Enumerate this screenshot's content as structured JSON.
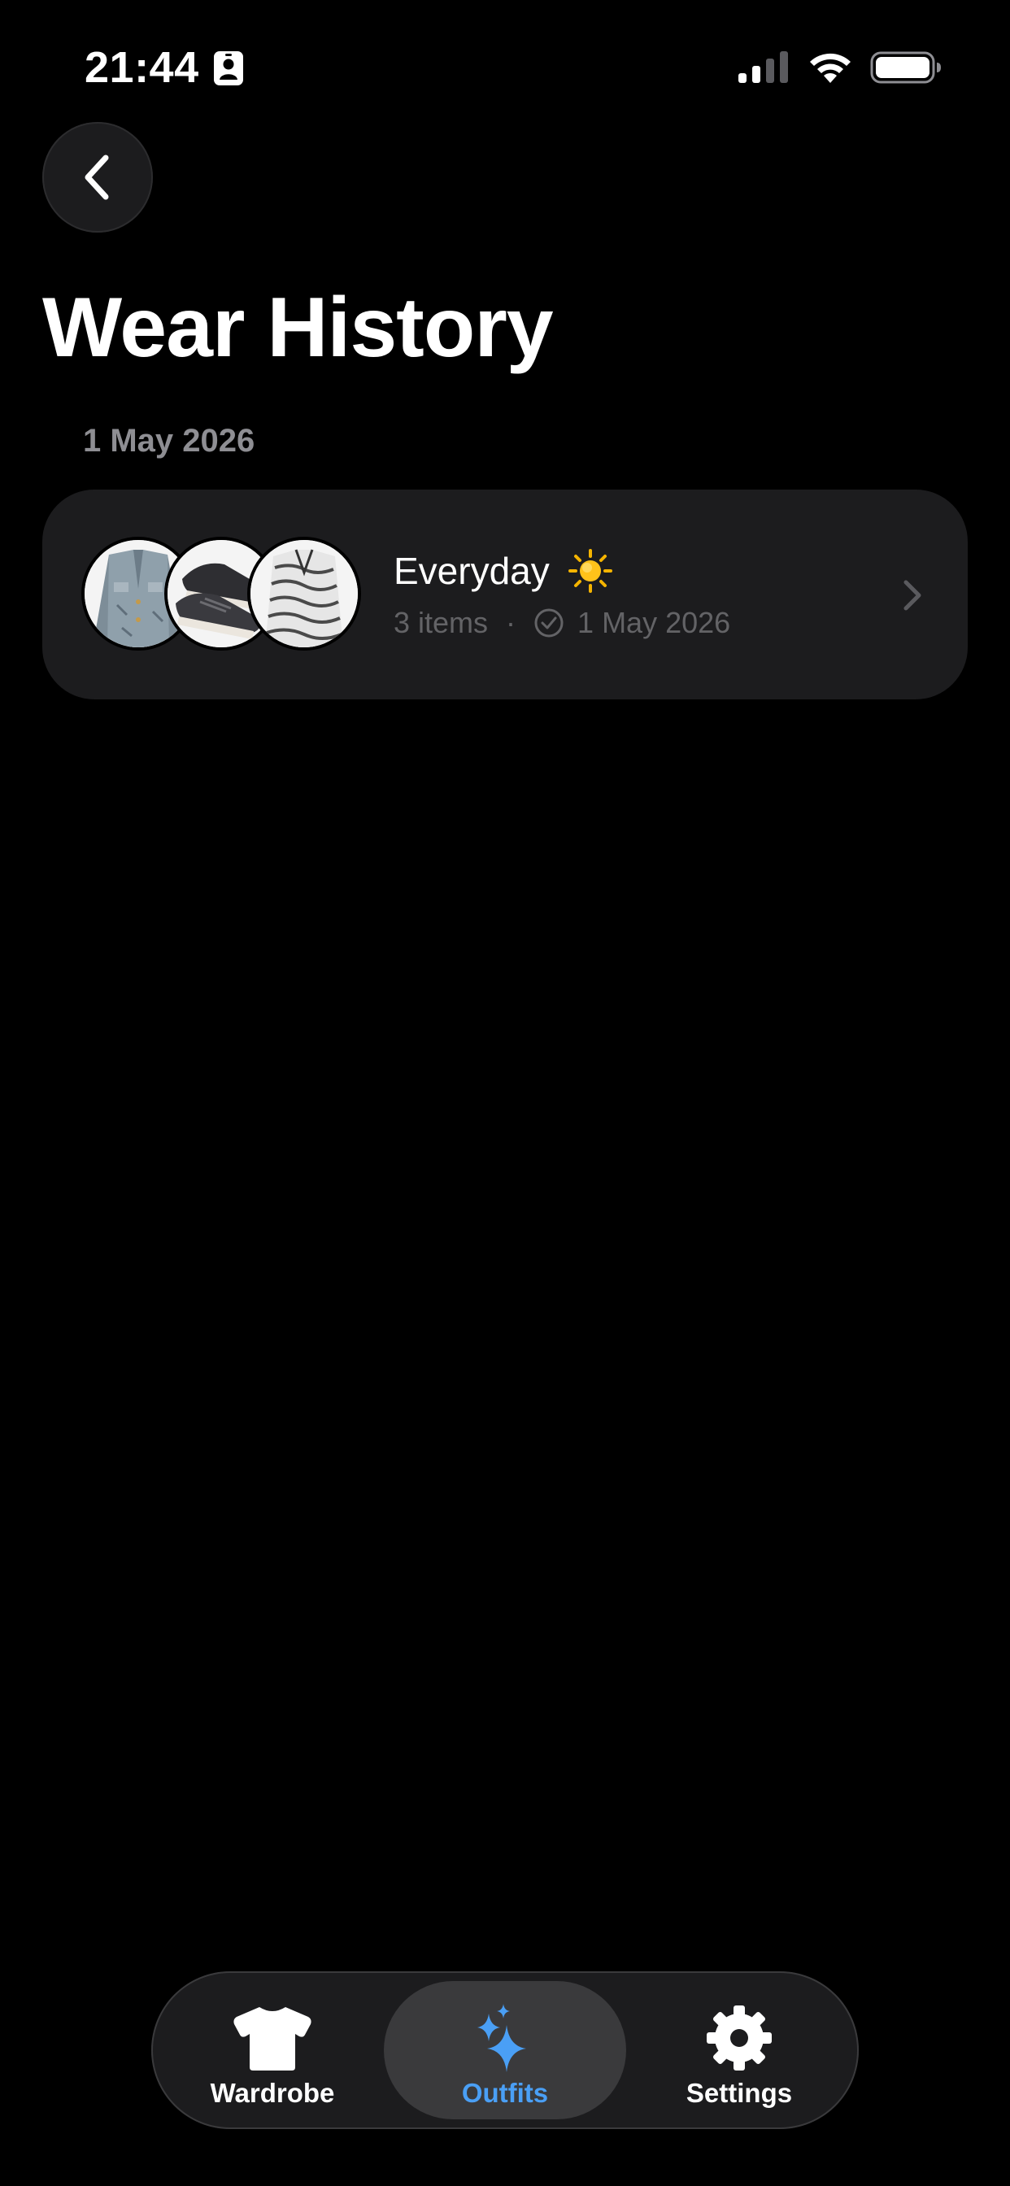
{
  "status_bar": {
    "time": "21:44",
    "icons": [
      "id-card-icon",
      "cellular-signal-icon",
      "wifi-icon",
      "battery-icon"
    ]
  },
  "header": {
    "back_icon": "chevron-left-icon",
    "title": "Wear History"
  },
  "sections": [
    {
      "date": "1 May 2026",
      "outfits": [
        {
          "name": "Everyday",
          "weather_icon": "sun-icon",
          "item_count": "3 items",
          "separator": "·",
          "worn_icon": "checkmark-circle-icon",
          "worn_date": "1 May 2026",
          "thumbnails": [
            "denim-jacket",
            "dark-sneakers",
            "patterned-shirt"
          ]
        }
      ]
    }
  ],
  "tab_bar": {
    "tabs": [
      {
        "label": "Wardrobe",
        "icon": "tshirt-icon",
        "selected": false
      },
      {
        "label": "Outfits",
        "icon": "sparkles-icon",
        "selected": true
      },
      {
        "label": "Settings",
        "icon": "gear-icon",
        "selected": false
      }
    ]
  },
  "colors": {
    "background": "#000000",
    "card": "#1c1c1e",
    "secondary_text": "#8e8e93",
    "tertiary_text": "#636366",
    "accent": "#4a9ff5",
    "selected_tab_bg": "#3a3a3c"
  }
}
